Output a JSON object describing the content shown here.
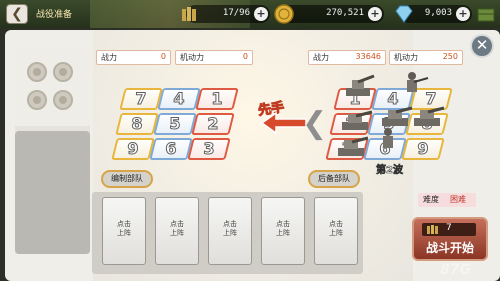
{
  "header": {
    "title": "战役准备",
    "resources": [
      {
        "icon": "military-supply-icon",
        "value": "17/96"
      },
      {
        "icon": "gold-coin-icon",
        "value": "270,521"
      },
      {
        "icon": "diamond-icon",
        "value": "9,003"
      }
    ]
  },
  "left_formation": {
    "power_label": "战力",
    "power_value": "0",
    "mobility_label": "机动力",
    "mobility_value": "0",
    "grid": [
      [
        "7",
        "4",
        "1"
      ],
      [
        "8",
        "5",
        "2"
      ],
      [
        "9",
        "6",
        "3"
      ]
    ],
    "edit_button": "编制部队"
  },
  "right_formation": {
    "power_label": "战力",
    "power_value": "33646",
    "mobility_label": "机动力",
    "mobility_value": "250",
    "grid": [
      [
        "1",
        "4",
        "7"
      ],
      [
        "2",
        "5",
        "8"
      ],
      [
        "3",
        "6",
        "9"
      ]
    ],
    "wave_label": "第2波",
    "reserve_button": "后备部队"
  },
  "first_move_label": "先手",
  "bench_slots": [
    {
      "line1": "点击",
      "line2": "上阵"
    },
    {
      "line1": "点击",
      "line2": "上阵"
    },
    {
      "line1": "点击",
      "line2": "上阵"
    },
    {
      "line1": "点击",
      "line2": "上阵"
    },
    {
      "line1": "点击",
      "line2": "上阵"
    }
  ],
  "difficulty": {
    "label": "难度",
    "value": "困难"
  },
  "start_battle": {
    "energy_cost": "7",
    "label": "战斗开始"
  },
  "watermark": "87G"
}
